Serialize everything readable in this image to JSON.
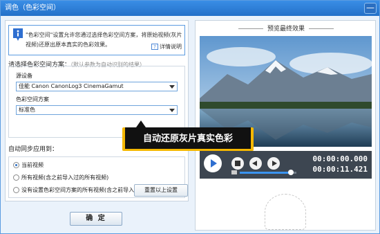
{
  "window": {
    "title": "调色（色彩空间）",
    "close_label": "—"
  },
  "info": {
    "text": "\"色彩空间\"设置允许您通过选择色彩空间方案，将原始视频(灰片视频)还原出原本真实的色彩效果。",
    "help_label": "详情说明"
  },
  "colorspace": {
    "label": "请选择色彩空间方案：",
    "hint": "（默认参数为自动识别的结果）",
    "source_label": "源设备",
    "source_value": "佳能 Canon CanonLog3 CinemaGamut",
    "scheme_label": "色彩空间方案",
    "scheme_value": "标准色"
  },
  "apply": {
    "label": "自动同步应用到：",
    "options": [
      {
        "label": "当前视频",
        "selected": true
      },
      {
        "label": "所有视频(含之前导入过的所有视频)",
        "selected": false
      },
      {
        "label": "没有设置色彩空间方案的所有视频(含之前导入过的所有视频)",
        "selected": false
      }
    ],
    "reset_label": "重置以上设置"
  },
  "ok_label": "确 定",
  "preview": {
    "title": "预览最终效果",
    "time_current": "00:00:00.000",
    "time_total": "00:00:11.421",
    "volume_level": 0.92
  },
  "callout": {
    "text": "自动还原灰片真实色彩"
  },
  "colors": {
    "accent": "#2370c8",
    "callout_border": "#f5b800"
  }
}
